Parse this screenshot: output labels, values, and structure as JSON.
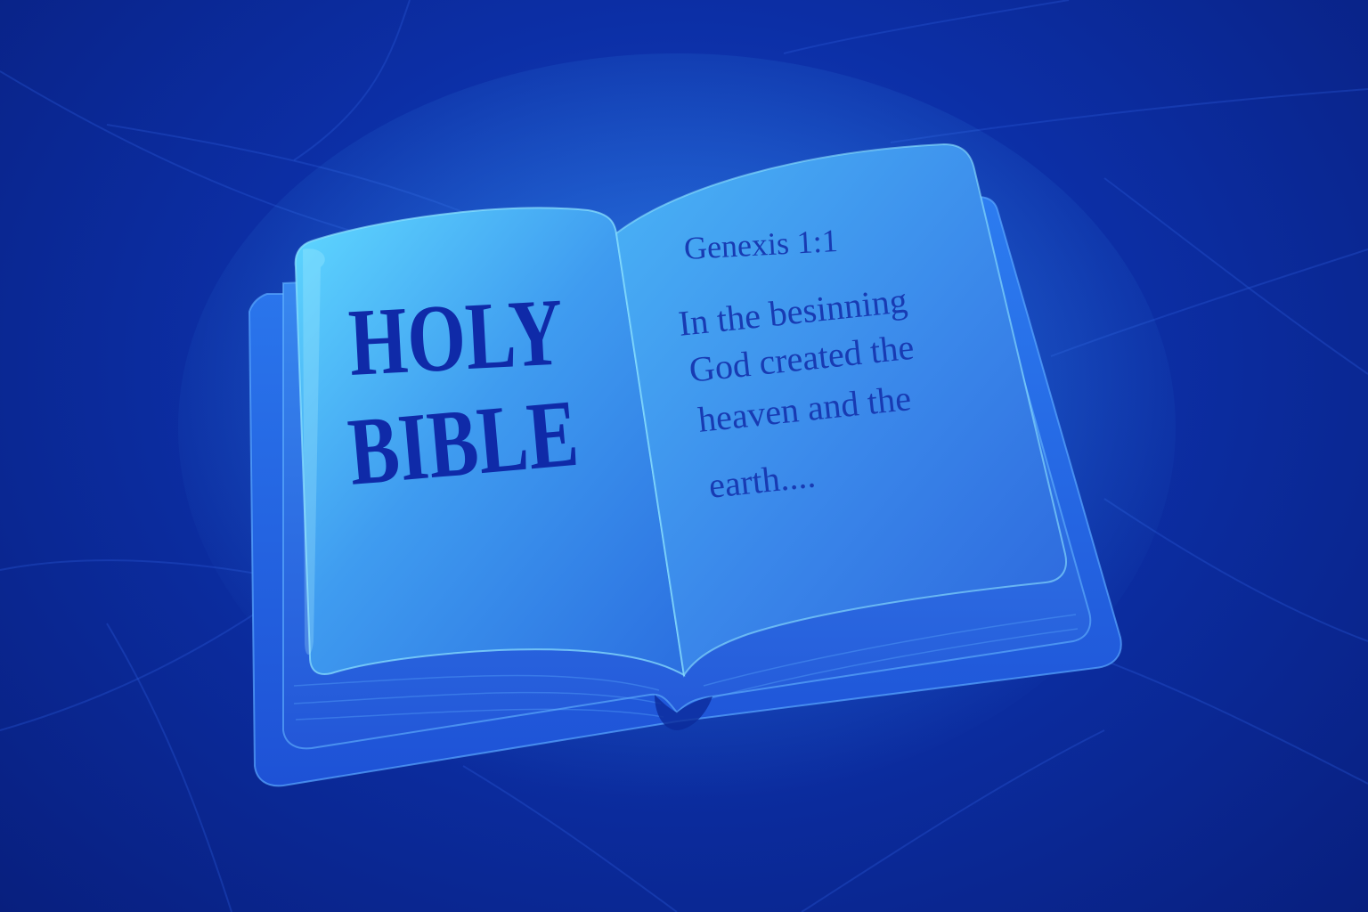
{
  "book": {
    "left_page": {
      "title_line_1": "HOLY",
      "title_line_2": "BIBLE"
    },
    "right_page": {
      "reference": "Genexis 1:1",
      "verse_lines": [
        "In the besinning",
        "God  created the",
        "heaven  and the",
        "earth...."
      ]
    }
  },
  "colors": {
    "background": "#0c2fa6",
    "page": "#3f9cf0",
    "text": "#0f2aa8"
  }
}
